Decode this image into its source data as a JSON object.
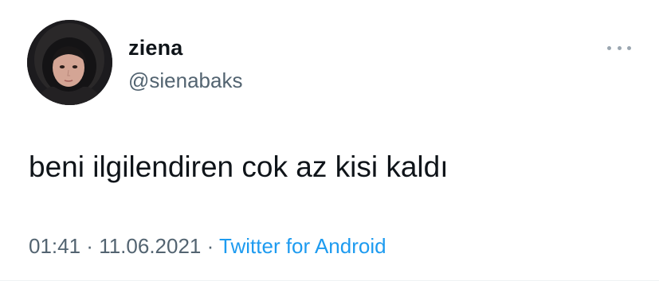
{
  "user": {
    "display_name": "ziena",
    "handle": "@sienabaks",
    "avatar_icon": "profile-photo"
  },
  "tweet": {
    "text": "beni ilgilendiren cok az kisi kaldı",
    "time": "01:41",
    "separator": " · ",
    "date": "11.06.2021",
    "source": "Twitter for Android"
  },
  "icons": {
    "more": "more-horizontal-icon"
  },
  "colors": {
    "text_primary": "#0f1419",
    "text_secondary": "#536471",
    "link": "#1d9bf0",
    "background": "#ffffff"
  }
}
